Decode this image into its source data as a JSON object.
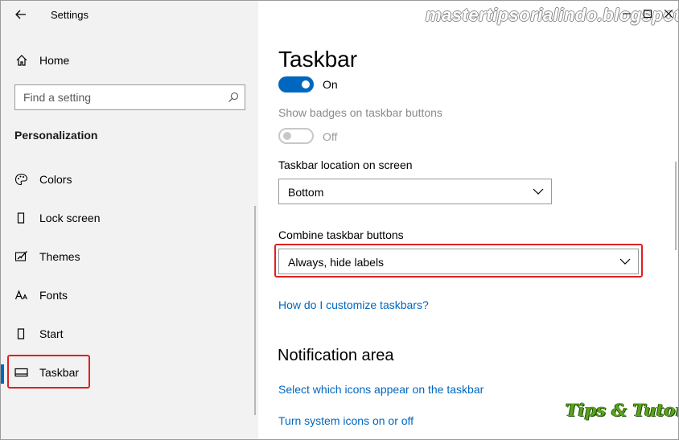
{
  "window": {
    "app_title": "Settings",
    "watermark": "mastertipsorialindo.blogspot.com"
  },
  "sidebar": {
    "home_label": "Home",
    "search_placeholder": "Find a setting",
    "section_heading": "Personalization",
    "items": [
      {
        "label": "Colors",
        "icon": "palette-icon",
        "selected": false
      },
      {
        "label": "Lock screen",
        "icon": "lock-screen-icon",
        "selected": false
      },
      {
        "label": "Themes",
        "icon": "themes-icon",
        "selected": false
      },
      {
        "label": "Fonts",
        "icon": "fonts-icon",
        "selected": false
      },
      {
        "label": "Start",
        "icon": "start-icon",
        "selected": false
      },
      {
        "label": "Taskbar",
        "icon": "taskbar-icon",
        "selected": true
      }
    ]
  },
  "main": {
    "page_title": "Taskbar",
    "toggle_top": {
      "state": "On"
    },
    "show_badges": {
      "label": "Show badges on taskbar buttons",
      "state": "Off"
    },
    "location": {
      "label": "Taskbar location on screen",
      "value": "Bottom"
    },
    "combine": {
      "label": "Combine taskbar buttons",
      "value": "Always, hide labels"
    },
    "help_link": "How do I customize taskbars?",
    "notification_heading": "Notification area",
    "notification_links": [
      "Select which icons appear on the taskbar",
      "Turn system icons on or off"
    ]
  },
  "overlay": {
    "badge_text": "Tips & Tutorial"
  },
  "colors": {
    "accent": "#0067c0",
    "highlight_border": "#e02020",
    "sidebar_bg": "#f2f2f2",
    "badge_green": "#5aa31a"
  }
}
